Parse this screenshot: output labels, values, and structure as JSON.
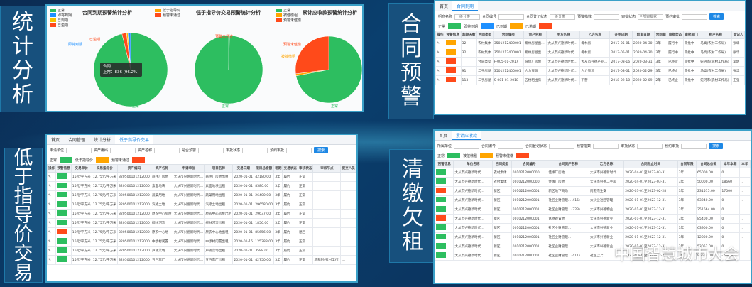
{
  "labels": {
    "stat": [
      "统",
      "计",
      "分",
      "析"
    ],
    "contract": [
      "合",
      "同",
      "预",
      "警"
    ],
    "lowprice": [
      "低",
      "于",
      "指",
      "导",
      "价",
      "交",
      "易"
    ],
    "arrears": [
      "清",
      "缴",
      "欠",
      "租"
    ]
  },
  "colors": {
    "green": "#2dbe60",
    "orange": "#ffa500",
    "red": "#ff4a1a",
    "blue": "#1e90ff",
    "yellow": "#f5c300"
  },
  "stats_panel": {
    "charts": [
      {
        "title": "合同到期预警统计分析",
        "legend": [
          "正常",
          "即将到期",
          "已到期",
          "已逾期"
        ],
        "labels": {
          "overdue": "已逾期",
          "due_soon": "即将到期",
          "normal": "正常"
        },
        "tooltip_title": "合同",
        "tooltip_value": "正常：836 (96.2%)"
      },
      {
        "title": "低于指导价交易预警统计分析",
        "legend": [
          "低于指导价",
          "预警未通过"
        ],
        "labels": {
          "warn": "预警未通过",
          "normal": "正常"
        }
      },
      {
        "title": "累计应收款预警统计分析",
        "legend": [
          "正常",
          "被催缴租",
          "预警未催缴"
        ],
        "labels": {
          "warn": "预警未催缴",
          "urged": "被催缴租",
          "normal": "正常"
        }
      }
    ]
  },
  "chart_data": [
    {
      "type": "pie",
      "title": "合同到期预警统计分析",
      "categories": [
        "正常",
        "即将到期",
        "已到期",
        "已逾期"
      ],
      "values": [
        96.2,
        1.2,
        0.6,
        2.0
      ]
    },
    {
      "type": "pie",
      "title": "低于指导价交易预警统计分析",
      "categories": [
        "正常",
        "预警未通过"
      ],
      "values": [
        99.6,
        0.4
      ]
    },
    {
      "type": "pie",
      "title": "累计应收款预警统计分析",
      "categories": [
        "正常",
        "预警未催缴",
        "被催缴租"
      ],
      "values": [
        72,
        27,
        1
      ]
    }
  ],
  "contract_panel": {
    "tabs": [
      "首页",
      "合同到期"
    ],
    "filters": [
      "招商名称",
      "一级分类",
      "合同编号",
      "合同登记状态",
      "一级分类",
      "预警指数",
      "审批状态",
      "全部审批状",
      "预约审批"
    ],
    "search": "搜索",
    "legend": [
      "正常",
      "即将到期",
      "已到期",
      "已逾期"
    ],
    "headers": [
      "操作",
      "预警信息",
      "超期天数",
      "合同类型",
      "合同编号",
      "资产名称",
      "甲方名称",
      "乙方名称",
      "开始日期",
      "结束日期",
      "合同期",
      "审批状态",
      "审批部门",
      "租户名称",
      "登记人"
    ],
    "rows": [
      {
        "color": "#ffa500",
        "days": "32",
        "type": "农村集体",
        "no": "3501212400001",
        "asset": "椰林房屋出…",
        "party_a": "大从市兴德新时代…",
        "party_b": "椰林房",
        "start": "2017-05-01",
        "end": "2020-04-30",
        "term": "3年",
        "status": "履行中",
        "dept": "审批中",
        "tenant": "马高(农村工作局)",
        "reg": "张华"
      },
      {
        "color": "#ffa500",
        "days": "32",
        "type": "农村集体",
        "no": "3501212400001",
        "asset": "椰林房屋出…",
        "party_a": "大从市兴德新时代…",
        "party_b": "椰林房",
        "start": "2017-05-01",
        "end": "2020-04-30",
        "term": "3年",
        "status": "履行中",
        "dept": "审批中",
        "tenant": "马高(农村工作局)",
        "reg": "张华"
      },
      {
        "color": "#ff4a1a",
        "days": "",
        "type": "合同类型",
        "no": "F-005-01-2017",
        "asset": "低价厂房地",
        "party_a": "大从市兴德新时代…",
        "party_b": "大从市兴德产业…",
        "start": "2017-03-16",
        "end": "2020-03-31",
        "term": "3年",
        "status": "已终止",
        "dept": "审批中",
        "tenant": "蛇珂市(农村工作局)",
        "reg": "李明"
      },
      {
        "color": "#ff4a1a",
        "days": "91",
        "type": "二手房屋",
        "no": "3501212400001",
        "asset": "人力资源",
        "party_a": "大从市兴德新时代…",
        "party_b": "人力资源",
        "start": "2017-03-01",
        "end": "2020-02-29",
        "term": "3年",
        "status": "已终止",
        "dept": "审批中",
        "tenant": "马高(农村工作局)",
        "reg": "张华"
      },
      {
        "color": "#ff4a1a",
        "days": "113",
        "type": "二手房屋",
        "no": "S-001-01-2018",
        "asset": "五楼租出房",
        "party_a": "大从市兴德新时代…",
        "party_b": "下营",
        "start": "2018-02-10",
        "end": "2020-02-09",
        "term": "2年",
        "status": "已终止",
        "dept": "审批中",
        "tenant": "蛇珂市(农村工作局)",
        "reg": "王强"
      }
    ]
  },
  "lowprice_panel": {
    "tabs": [
      "首页",
      "合同管理",
      "统计分析",
      "低于指导价交易"
    ],
    "filters": [
      "申请单位",
      "资产编码",
      "资产名称",
      "是否预警",
      "审批状态",
      "预约审批"
    ],
    "search": "搜索",
    "legend": [
      "正常",
      "低于指导价",
      "预警未通过"
    ],
    "headers": [
      "操作",
      "预警信息",
      "交易单价",
      "交易指导价",
      "资产编码",
      "资产名称",
      "申请单位",
      "项目名称",
      "交易日期",
      "项目总金额",
      "租期",
      "交易状态",
      "审核状态",
      "审核节点",
      "提交人员"
    ],
    "rows": [
      {
        "color": "#2dbe60",
        "price": "15元/平方米",
        "guide": "12.75元/平方米",
        "code": "320500101212000",
        "asset": "商住厂房地",
        "unit": "大从市兴德新时代…",
        "project": "商住厂房地出租",
        "date": "2020-01-01",
        "total": "42180.00",
        "term": "3年",
        "trade": "履约",
        "audit": "正常",
        "node": "",
        "user": ""
      },
      {
        "color": "#2dbe60",
        "price": "15元/平方米",
        "guide": "12.75元/平方米",
        "code": "320500101212000",
        "asset": "素面地块",
        "unit": "大从市兴德新时代…",
        "project": "素面地块出租",
        "date": "2020-01-01",
        "total": "8580.00",
        "term": "3年",
        "trade": "履约",
        "audit": "正常",
        "node": "",
        "user": ""
      },
      {
        "color": "#2dbe60",
        "price": "15元/平方米",
        "guide": "12.75元/平方米",
        "code": "320500101212000",
        "asset": "蔬菜用地",
        "unit": "大从市兴德新时代…",
        "project": "蔬菜用地出租",
        "date": "2020-01-01",
        "total": "26400.00",
        "term": "3年",
        "trade": "履约",
        "audit": "正常",
        "node": "",
        "user": ""
      },
      {
        "color": "#2dbe60",
        "price": "15元/平方米",
        "guide": "12.75元/平方米",
        "code": "320500101212000",
        "asset": "汽修土地",
        "unit": "大从市兴德新时代…",
        "project": "汽修土地出租",
        "date": "2020-01-01",
        "total": "296580.00",
        "term": "3年",
        "trade": "履约",
        "audit": "正常",
        "node": "",
        "user": ""
      },
      {
        "color": "#2dbe60",
        "price": "15元/平方米",
        "guide": "12.75元/平方米",
        "code": "320500101212000",
        "asset": "原农中心房屋",
        "unit": "大从市兴德新时代…",
        "project": "原农中心房屋出租",
        "date": "2020-01-01",
        "total": "29637.00",
        "term": "3年",
        "trade": "履约",
        "audit": "正常",
        "node": "",
        "user": ""
      },
      {
        "color": "#2dbe60",
        "price": "15元/平方米",
        "guide": "12.75元/平方米",
        "code": "320500101212000",
        "asset": "柳林河流",
        "unit": "大从市兴德新时代…",
        "project": "柳林河流出租",
        "date": "2020-01-01",
        "total": "1856.00",
        "term": "3年",
        "trade": "履约",
        "audit": "正常",
        "node": "",
        "user": ""
      },
      {
        "color": "#ff4a1a",
        "price": "10元/平方米",
        "guide": "12.75元/平方米",
        "code": "320500101212000",
        "asset": "原农中心地",
        "unit": "大从市兴德新时代…",
        "project": "原农中心地出租",
        "date": "2020-01-01",
        "total": "85656.00",
        "term": "3年",
        "trade": "履约",
        "audit": "退回",
        "node": "",
        "user": ""
      },
      {
        "color": "#2dbe60",
        "price": "15元/平方米",
        "guide": "12.75元/平方米",
        "code": "320500101212000",
        "asset": "中涉村闲置",
        "unit": "大从市兴德新时代…",
        "project": "中涉村闲置出租",
        "date": "2020-01-15",
        "total": "125288.00",
        "term": "3年",
        "trade": "履约",
        "audit": "正常",
        "node": "",
        "user": ""
      },
      {
        "color": "#2dbe60",
        "price": "15元/平方米",
        "guide": "12.75元/平方米",
        "code": "320500101212000",
        "asset": "芦浦菜场",
        "unit": "大从市兴德新时代…",
        "project": "芦浦菜场出租",
        "date": "2020-01-01",
        "total": "3588.00",
        "term": "3年",
        "trade": "履约",
        "audit": "正常",
        "node": "",
        "user": ""
      },
      {
        "color": "#2dbe60",
        "price": "15元/平方米",
        "guide": "12.75元/平方米",
        "code": "320500101212000",
        "asset": "五汽车厂",
        "unit": "大从市兴德新时代…",
        "project": "五汽车厂出租",
        "date": "2020-01-01",
        "total": "42750.00",
        "term": "3年",
        "trade": "履约",
        "audit": "正常",
        "node": "马和利(农村工作)",
        "user": "…"
      }
    ]
  },
  "arrears_panel": {
    "tabs": [
      "首页",
      "累计应收款"
    ],
    "filters": [
      "所属单位",
      "合同编号",
      "合同登记状态",
      "预警指数",
      "审批状态",
      "预约审批"
    ],
    "search": "搜索",
    "legend": [
      "正常",
      "被催缴租",
      "预警未催缴"
    ],
    "headers": [
      "预警信息",
      "单位名称",
      "合同类型",
      "合同编号",
      "合同资产名称",
      "乙方名称",
      "合同起止时间",
      "合同年限",
      "合同总价款",
      "本年本期",
      "本年"
    ],
    "rows": [
      {
        "color": "#2dbe60",
        "unit": "大从市兴德新时代…",
        "type": "农村集体",
        "no": "0010212000000",
        "asset": "佳缘厂房地",
        "party_b": "大从市兴德新时代",
        "term": "2020-04-01至2023-03-31",
        "years": "3年",
        "total": "65000.00",
        "cur": "0",
        "year": "…"
      },
      {
        "color": "#2dbe60",
        "unit": "大从市兴德新时代…",
        "type": "农村集体",
        "no": "0010212000000",
        "asset": "佳缘厂房地",
        "party_b": "大从市兴德二手房",
        "term": "2020-04-01至2023-03-31",
        "years": "3年",
        "total": "50000.00",
        "cur": "18660",
        "year": "…"
      },
      {
        "color": "#ff4a1a",
        "unit": "大从市兴德新时代…",
        "type": "新区",
        "no": "0010212000001",
        "asset": "新区地下商场",
        "party_b": "南港杰生安",
        "term": "2020-03-01至2023-02-28",
        "years": "3年",
        "total": "231515.00",
        "cur": "17000",
        "year": "…"
      },
      {
        "color": "#2dbe60",
        "unit": "大从市兴德新时代…",
        "type": "新区",
        "no": "0010212000001",
        "asset": "社区业财管理…(415)",
        "party_b": "大从业社区管理",
        "term": "2020-01-01至2023-12-31",
        "years": "3年",
        "total": "63240.00",
        "cur": "0",
        "year": "…"
      },
      {
        "color": "#2dbe60",
        "unit": "大从市兴德新时代…",
        "type": "新区",
        "no": "0010212000001",
        "asset": "社区业财管理…(323)",
        "party_b": "大从市兴德物业",
        "term": "2020-01-01至2023-12-31",
        "years": "3年",
        "total": "251664.00",
        "cur": "0",
        "year": "…"
      },
      {
        "color": "#ff4a1a",
        "unit": "大从市兴德新时代…",
        "type": "新区",
        "no": "0010212000001",
        "asset": "富港观置地",
        "party_b": "大从市兴德新业",
        "term": "2020-01-01至2023-12-31",
        "years": "3年",
        "total": "85400.00",
        "cur": "0",
        "year": "…"
      },
      {
        "color": "#2dbe60",
        "unit": "大从市兴德新时代…",
        "type": "新区",
        "no": "0010212000001",
        "asset": "社区业财管理…",
        "party_b": "大从市兴德新业",
        "term": "2020-01-01至2023-12-31",
        "years": "3年",
        "total": "63900.00",
        "cur": "0",
        "year": "…"
      },
      {
        "color": "#2dbe60",
        "unit": "大从市兴德新时代…",
        "type": "新区",
        "no": "0010212000001",
        "asset": "社区业财管理…",
        "party_b": "大从市兴德新业",
        "term": "2020-01-01至2023-12-31",
        "years": "3年",
        "total": "12000.00",
        "cur": "0",
        "year": "…"
      },
      {
        "color": "#2dbe60",
        "unit": "大从市兴德新时代…",
        "type": "新区",
        "no": "0010212000001",
        "asset": "社区业财管理…",
        "party_b": "大从市兴德新业",
        "term": "2020-01-01至2023-12-31",
        "years": "3年",
        "total": "53052.00",
        "cur": "0",
        "year": "…"
      },
      {
        "color": "#2dbe60",
        "unit": "大从市兴德新时代…",
        "type": "新区",
        "no": "0010212000001",
        "asset": "社区业财管理…(411)",
        "party_b": "社区业财",
        "term": "2020-01-01至2023-12-31",
        "years": "3年",
        "total": "96512.00",
        "cur": "-28844",
        "year": "…"
      }
    ]
  },
  "watermark": {
    "text": "中国智慧城市大会"
  }
}
